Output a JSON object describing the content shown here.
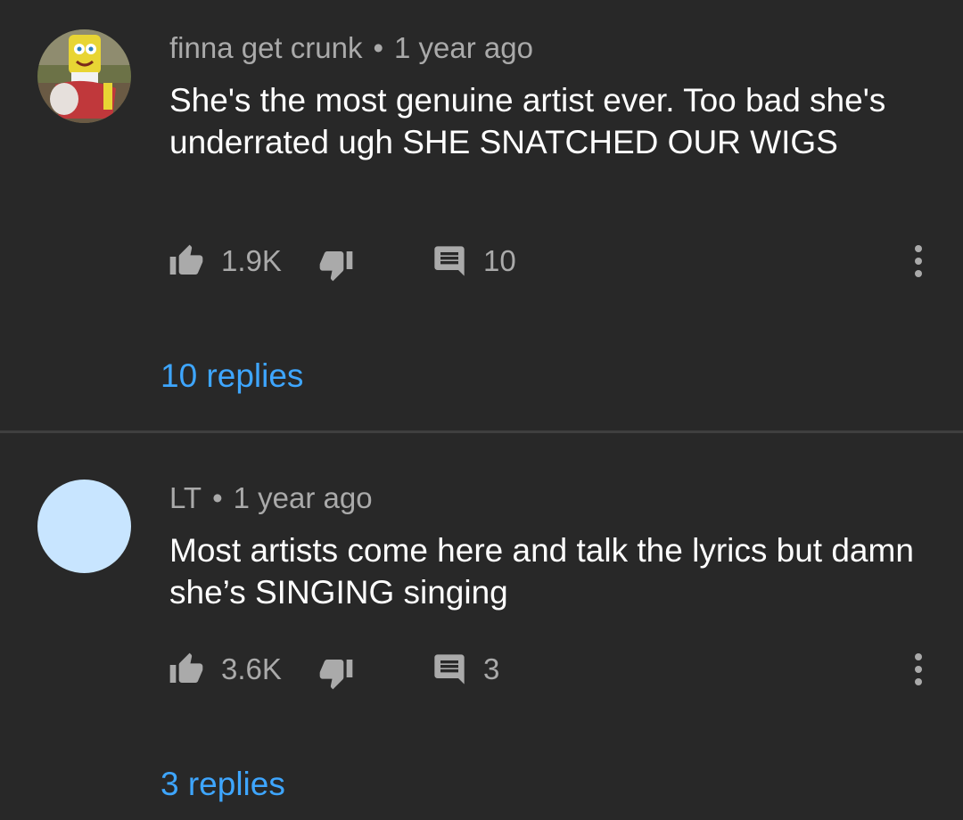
{
  "comments": [
    {
      "author": "finna get crunk",
      "separator": "•",
      "time": "1 year ago",
      "text": "She's the most genuine artist ever. Too bad she's underrated ugh SHE SNATCHED OUR WIGS",
      "likes": "1.9K",
      "reply_count": "10",
      "replies_label": "10 replies",
      "avatar": "spongebob-photo"
    },
    {
      "author": "LT",
      "separator": "•",
      "time": "1 year ago",
      "text": "Most artists come here and talk the lyrics but damn she’s SINGING singing",
      "likes": "3.6K",
      "reply_count": "3",
      "replies_label": "3 replies",
      "avatar_color": "#c8e5ff"
    }
  ],
  "icons": {
    "like": "thumbs-up-icon",
    "dislike": "thumbs-down-icon",
    "reply": "comment-icon",
    "more": "more-vert-icon"
  },
  "colors": {
    "background": "#282828",
    "link": "#3ea6ff",
    "secondary_text": "#aaaaaa"
  }
}
